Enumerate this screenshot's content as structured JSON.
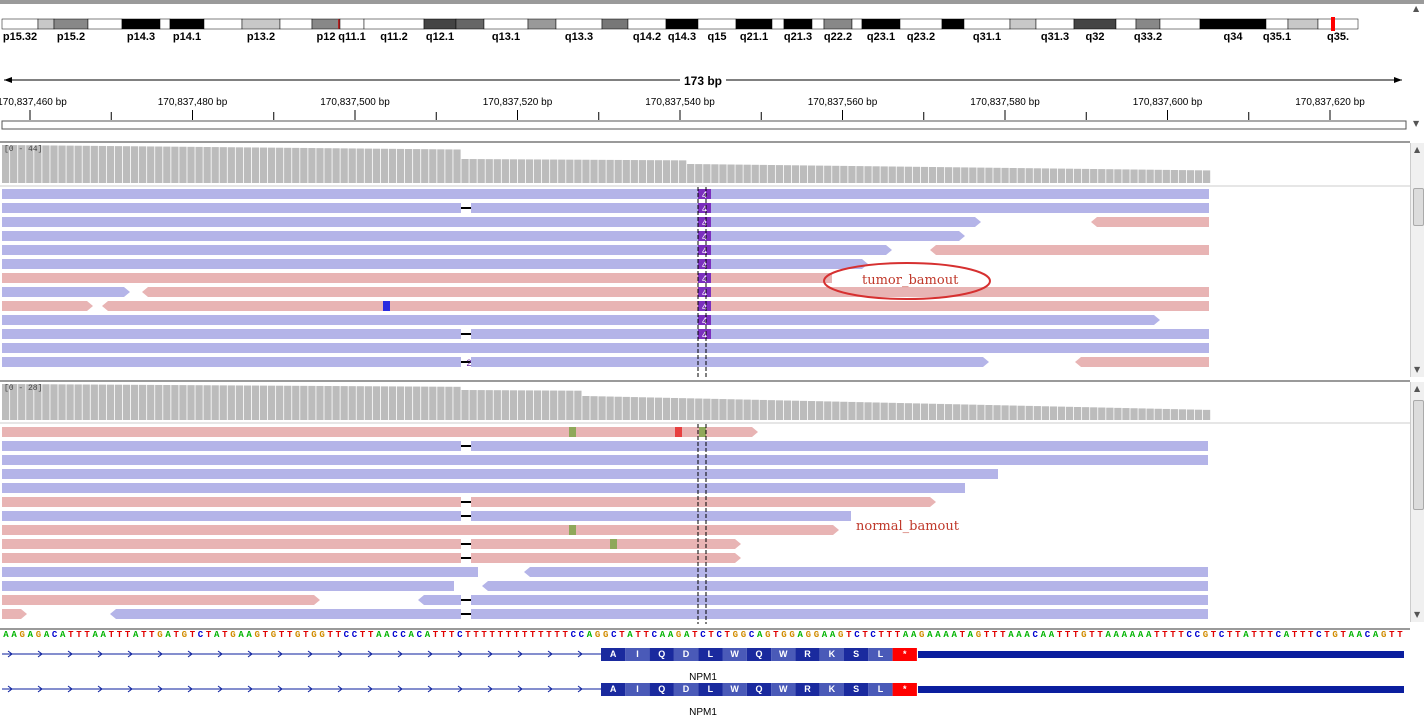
{
  "ideogram": {
    "bands": [
      {
        "label": "p15.32",
        "color": "#ffffff"
      },
      {
        "label": "",
        "color": "#c8c8c8"
      },
      {
        "label": "p15.2",
        "color": "#888888"
      },
      {
        "label": "",
        "color": "#ffffff"
      },
      {
        "label": "p14.3",
        "color": "#000000"
      },
      {
        "label": "",
        "color": "#ffffff"
      },
      {
        "label": "p14.1",
        "color": "#000000"
      },
      {
        "label": "",
        "color": "#ffffff"
      },
      {
        "label": "p13.2",
        "color": "#c8c8c8"
      },
      {
        "label": "",
        "color": "#ffffff"
      },
      {
        "label": "p12",
        "color": "#888888"
      },
      {
        "label": "q11.1",
        "color": "#ffffff"
      },
      {
        "label": "q11.2",
        "color": "#ffffff"
      },
      {
        "label": "q12.1",
        "color": "#444444"
      },
      {
        "label": "",
        "color": "#666666"
      },
      {
        "label": "q13.1",
        "color": "#ffffff"
      },
      {
        "label": "",
        "color": "#999999"
      },
      {
        "label": "q13.3",
        "color": "#ffffff"
      },
      {
        "label": "",
        "color": "#777777"
      },
      {
        "label": "q14.2",
        "color": "#ffffff"
      },
      {
        "label": "q14.3",
        "color": "#000000"
      },
      {
        "label": "q15",
        "color": "#ffffff"
      },
      {
        "label": "q21.1",
        "color": "#000000"
      },
      {
        "label": "",
        "color": "#ffffff"
      },
      {
        "label": "q21.3",
        "color": "#000000"
      },
      {
        "label": "",
        "color": "#ffffff"
      },
      {
        "label": "q22.2",
        "color": "#888888"
      },
      {
        "label": "",
        "color": "#ffffff"
      },
      {
        "label": "q23.1",
        "color": "#000000"
      },
      {
        "label": "q23.2",
        "color": "#ffffff"
      },
      {
        "label": "",
        "color": "#000000"
      },
      {
        "label": "q31.1",
        "color": "#ffffff"
      },
      {
        "label": "",
        "color": "#c8c8c8"
      },
      {
        "label": "q31.3",
        "color": "#ffffff"
      },
      {
        "label": "q32",
        "color": "#444444"
      },
      {
        "label": "",
        "color": "#ffffff"
      },
      {
        "label": "q33.2",
        "color": "#888888"
      },
      {
        "label": "",
        "color": "#ffffff"
      },
      {
        "label": "q34",
        "color": "#000000"
      },
      {
        "label": "q35.1",
        "color": "#ffffff"
      },
      {
        "label": "",
        "color": "#c8c8c8"
      },
      {
        "label": "q35.",
        "color": "#ffffff"
      }
    ],
    "centromere_color": "#b22222",
    "current_region_color": "#ff0000"
  },
  "ruler": {
    "span": "173 bp",
    "ticks": [
      "170,837,460 bp",
      "170,837,480 bp",
      "170,837,500 bp",
      "170,837,520 bp",
      "170,837,540 bp",
      "170,837,560 bp",
      "170,837,580 bp",
      "170,837,600 bp",
      "170,837,620 bp"
    ]
  },
  "tracks": {
    "tumor": {
      "coverage_range": "[0 - 44]",
      "annotation": "tumor_bamout",
      "insertion_label": "4",
      "deletion_label": "2"
    },
    "normal": {
      "coverage_range": "[0 - 28]",
      "annotation": "normal_bamout"
    }
  },
  "sequence": "AAGAGACATTTAATTTATTGATGTCTATGAAGTGTTGTGGTTCCTTAACCACATTTCTTTTTTTTTTTTTCCAGGCTATTCAAGATCTCTGGCAGTGGAGGAAGTCTCTTTAAGAAAATAGTTTAAACAATTTGTTAAAAAATTTTCCGTCTTATTTCATTTCTGTAACAGTT",
  "base_colors": {
    "A": "#00b400",
    "C": "#0000d0",
    "G": "#d18c00",
    "T": "#e00000"
  },
  "genes": [
    {
      "name": "NPM1",
      "amino_acids": [
        "A",
        "I",
        "Q",
        "D",
        "L",
        "W",
        "Q",
        "W",
        "R",
        "K",
        "S",
        "L",
        "*"
      ]
    },
    {
      "name": "NPM1",
      "amino_acids": [
        "A",
        "I",
        "Q",
        "D",
        "L",
        "W",
        "Q",
        "W",
        "R",
        "K",
        "S",
        "L",
        "*"
      ]
    }
  ],
  "colors": {
    "forward_read": "#b4b4e8",
    "reverse_read": "#e8b4b4",
    "coverage": "#bcbcbc",
    "insertion": "#7b2fbe",
    "gene": "#0a1e9e",
    "stop": "#ff0000"
  }
}
